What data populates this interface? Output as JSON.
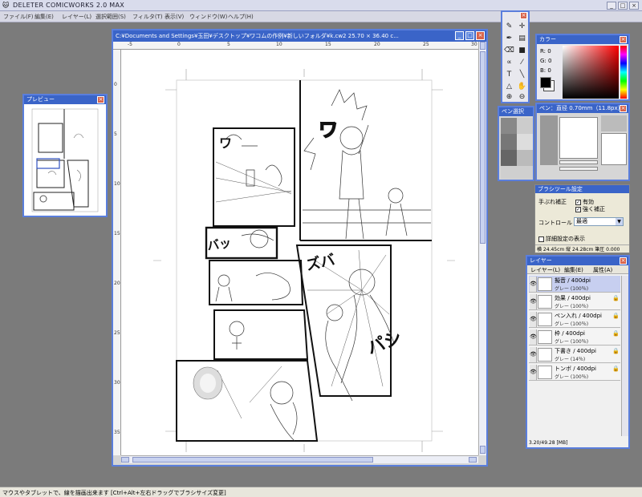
{
  "app": {
    "title": "DELETER COMICWORKS 2.0 MAX",
    "menus": [
      "ファイル(F)",
      "編集(E)",
      "レイヤー(L)",
      "選択範囲(S)",
      "フィルタ(T)",
      "表示(V)",
      "ウィンドウ(W)",
      "ヘルプ(H)"
    ],
    "window_buttons": [
      "_",
      "□",
      "×"
    ]
  },
  "document": {
    "title": "C:¥Documents and Settings¥玉田¥デスクトップ¥ワコムの作例¥新しいフォルダ¥k.cw2   25.70 × 36.40 c...",
    "ruler_top": [
      "-5",
      "0",
      "5",
      "10",
      "15",
      "20",
      "25",
      "30"
    ],
    "ruler_left": [
      "0",
      "5",
      "10",
      "15",
      "20",
      "25",
      "30",
      "35"
    ],
    "sfx": {
      "p1": "ワ",
      "p2": "バッ",
      "p3": "ズバ",
      "p4": "パシ",
      "p5": "ワ"
    }
  },
  "preview": {
    "title": "プレビュー"
  },
  "color": {
    "title": "カラー",
    "r": "R: 0",
    "g": "G: 0",
    "b": "B: 0",
    "fg": "#000000",
    "bg": "#ffffff"
  },
  "pen_select": {
    "title": "ペン選択"
  },
  "pen": {
    "title": "ペン：直径 0.70mm（11.8px）"
  },
  "brush_settings": {
    "title": "ブラシツール設定",
    "stabilizer_label": "手ぶれ補正",
    "enabled_label": "有効",
    "strong_label": "強く補正",
    "control_label": "コントロール",
    "control_value": "最適",
    "detail_label": "詳細設定の表示",
    "readout": "横 24.45cm 縦 24.28cm  筆圧 0.000"
  },
  "layers": {
    "title": "レイヤー",
    "menu": [
      "レイヤー(L)",
      "編集(E)",
      "属性(A)"
    ],
    "items": [
      {
        "name": "擬音 / 400dpi",
        "sub": "グレー (100％)",
        "active": true
      },
      {
        "name": "効果 / 400dpi",
        "sub": "グレー (100％)",
        "active": false
      },
      {
        "name": "ペン入れ / 400dpi",
        "sub": "グレー (100％)",
        "active": false
      },
      {
        "name": "枠 / 400dpi",
        "sub": "グレー (100％)",
        "active": false
      },
      {
        "name": "下書き / 400dpi",
        "sub": "グレー (14％)",
        "active": false
      },
      {
        "name": "トンボ / 400dpi",
        "sub": "グレー (100％)",
        "active": false
      }
    ],
    "memory": "3.20/49.28 [MB]"
  },
  "status": {
    "text": "マウスやタブレットで、線を描画出来ます [Ctrl+Alt+左右ドラッグでブラシサイズ変更]"
  }
}
